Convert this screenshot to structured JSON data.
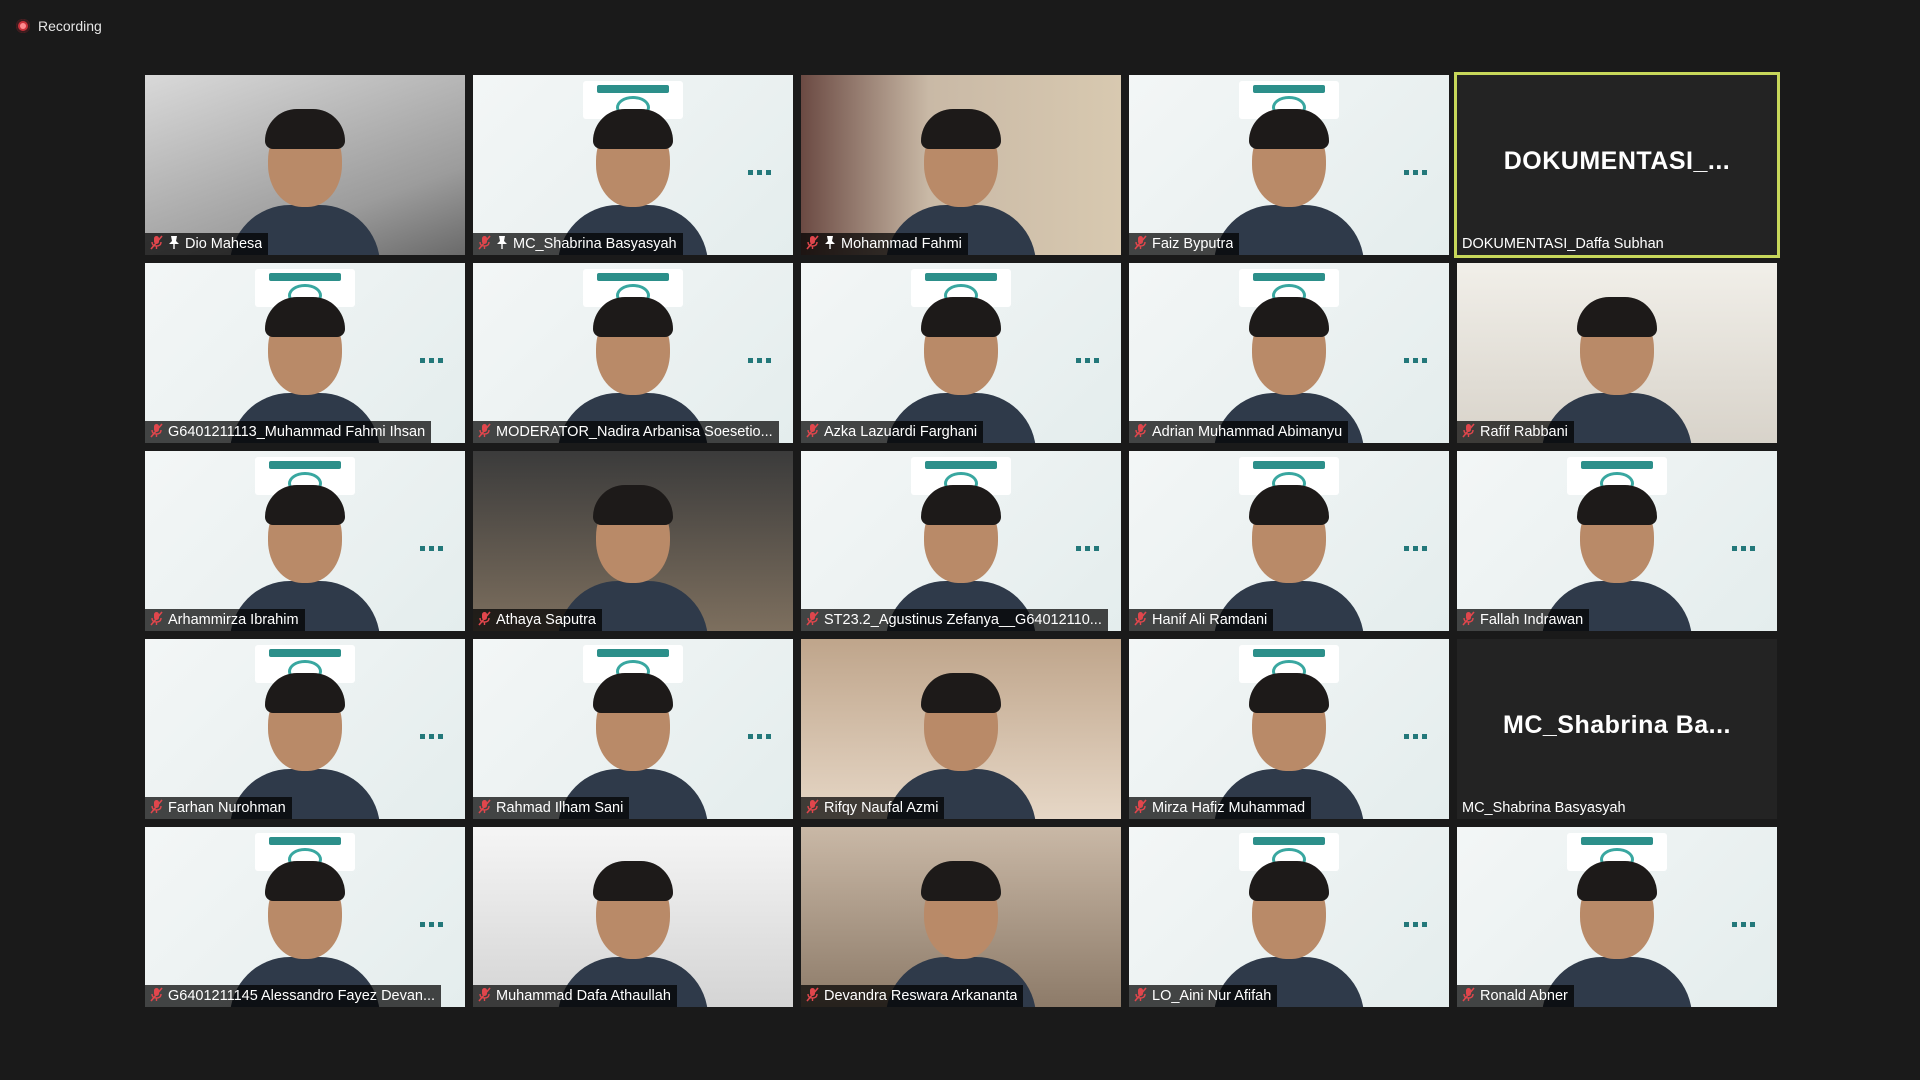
{
  "recording": {
    "label": "Recording"
  },
  "participants": [
    {
      "name": "Dio Mahesa",
      "muted": true,
      "pinned": true,
      "bg": "room1"
    },
    {
      "name": "MC_Shabrina Basyasyah",
      "muted": true,
      "pinned": true,
      "bg": "webinar"
    },
    {
      "name": "Mohammad Fahmi",
      "muted": true,
      "pinned": true,
      "bg": "room6"
    },
    {
      "name": "Faiz Byputra",
      "muted": true,
      "pinned": false,
      "bg": "webinar"
    },
    {
      "name": "DOKUMENTASI_Daffa Subhan",
      "muted": false,
      "pinned": false,
      "bg": "dark",
      "big_label": "DOKUMENTASI_...",
      "active": true
    },
    {
      "name": "G6401211113_Muhammad Fahmi Ihsan",
      "muted": true,
      "pinned": false,
      "bg": "webinar"
    },
    {
      "name": "MODERATOR_Nadira Arbanisa Soesetio...",
      "muted": true,
      "pinned": false,
      "bg": "webinar"
    },
    {
      "name": "Azka Lazuardi Farghani",
      "muted": true,
      "pinned": false,
      "bg": "webinar"
    },
    {
      "name": "Adrian Muhammad Abimanyu",
      "muted": true,
      "pinned": false,
      "bg": "webinar"
    },
    {
      "name": "Rafif Rabbani",
      "muted": true,
      "pinned": false,
      "bg": "room5"
    },
    {
      "name": "Arhammirza Ibrahim",
      "muted": true,
      "pinned": false,
      "bg": "webinar"
    },
    {
      "name": "Athaya Saputra",
      "muted": true,
      "pinned": false,
      "bg": "room3"
    },
    {
      "name": "ST23.2_Agustinus Zefanya__G64012110...",
      "muted": true,
      "pinned": false,
      "bg": "webinar"
    },
    {
      "name": "Hanif Ali Ramdani",
      "muted": true,
      "pinned": false,
      "bg": "webinar"
    },
    {
      "name": "Fallah Indrawan",
      "muted": true,
      "pinned": false,
      "bg": "webinar"
    },
    {
      "name": "Farhan Nurohman",
      "muted": true,
      "pinned": false,
      "bg": "webinar"
    },
    {
      "name": "Rahmad Ilham Sani",
      "muted": true,
      "pinned": false,
      "bg": "webinar"
    },
    {
      "name": "Rifqy Naufal Azmi",
      "muted": true,
      "pinned": false,
      "bg": "room4"
    },
    {
      "name": "Mirza Hafiz Muhammad",
      "muted": true,
      "pinned": false,
      "bg": "webinar"
    },
    {
      "name": "MC_Shabrina Basyasyah",
      "muted": false,
      "pinned": false,
      "bg": "dark",
      "big_label": "MC_Shabrina  Ba..."
    },
    {
      "name": "G6401211145 Alessandro Fayez Devan...",
      "muted": true,
      "pinned": false,
      "bg": "webinar"
    },
    {
      "name": "Muhammad Dafa Athaullah",
      "muted": true,
      "pinned": false,
      "bg": "room7"
    },
    {
      "name": "Devandra Reswara Arkananta",
      "muted": true,
      "pinned": false,
      "bg": "room2"
    },
    {
      "name": "LO_Aini Nur Afifah",
      "muted": true,
      "pinned": false,
      "bg": "webinar"
    },
    {
      "name": "Ronald Abner",
      "muted": true,
      "pinned": false,
      "bg": "webinar"
    }
  ],
  "colors": {
    "active_border": "#c7d75a",
    "mute_red": "#e0464c",
    "background": "#1a1a1a"
  },
  "icons": {
    "mute": "mic-muted-icon",
    "pin": "pin-icon",
    "recording": "recording-dot-icon"
  }
}
